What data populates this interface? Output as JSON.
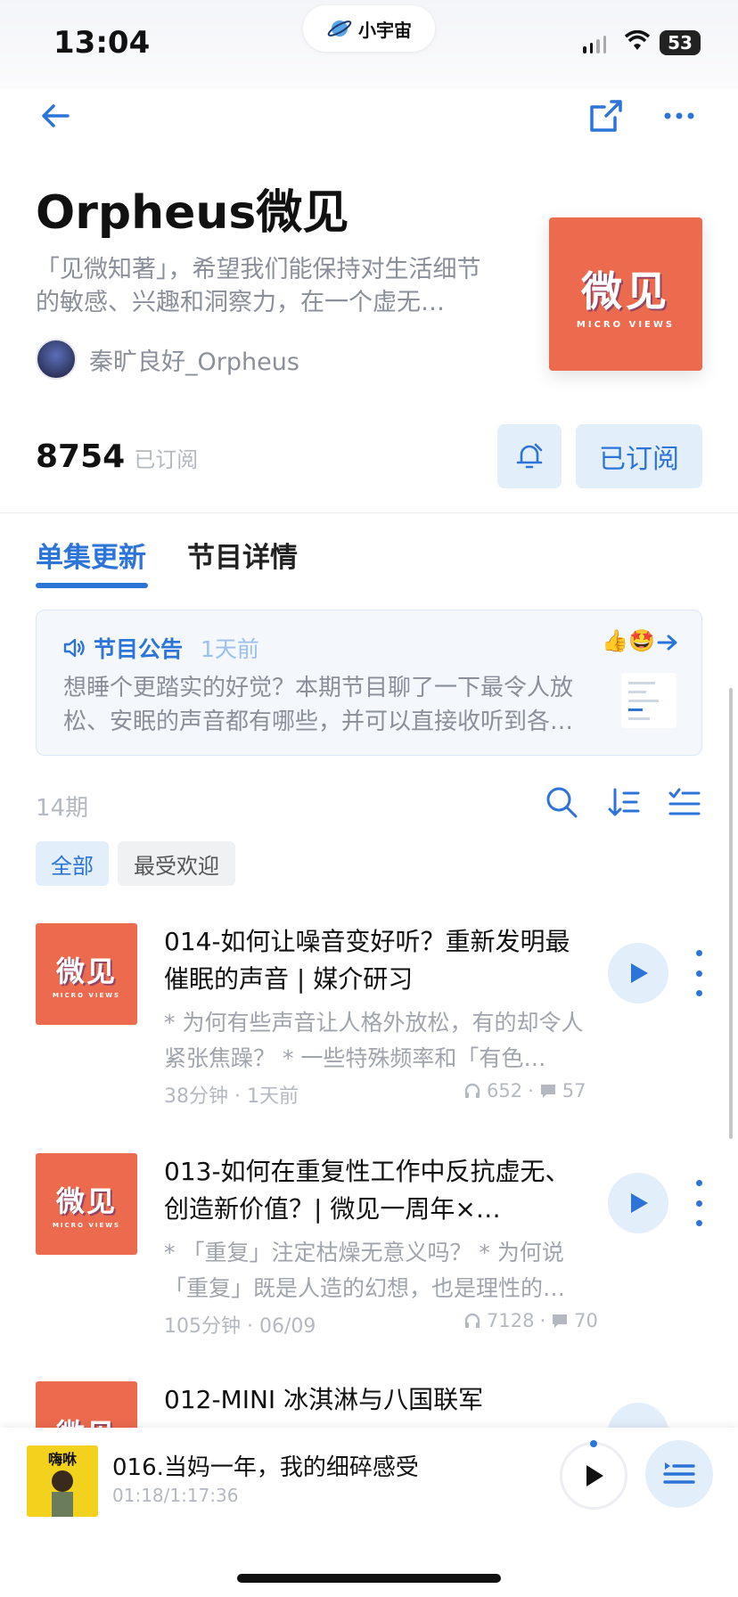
{
  "status": {
    "time": "13:04",
    "app_pill": "小宇宙",
    "battery": "53"
  },
  "podcast": {
    "title": "Orpheus微见",
    "description": "「见微知著」，希望我们能保持对生活细节的敏感、兴趣和洞察力，在一个虚无…",
    "cover_text": "微见",
    "cover_subtext": "MICRO VIEWS",
    "author": "秦旷良好_Orpheus",
    "subscribers": "8754",
    "subscribers_label": "已订阅",
    "subscribe_button": "已订阅"
  },
  "tabs": [
    "单集更新",
    "节目详情"
  ],
  "announcement": {
    "label": "节目公告",
    "time": "1天前",
    "emoji": "👍🤩",
    "text": "想睡个更踏实的好觉？本期节目聊了一下最令人放松、安眠的声音都有哪些，并可以直接收听到各…"
  },
  "list": {
    "count": "14期",
    "filters": [
      "全部",
      "最受欢迎"
    ]
  },
  "episodes": [
    {
      "title": "014-如何让噪音变好听？重新发明最催眠的声音 | 媒介研习",
      "desc": "* 为何有些声音让人格外放松，有的却令人紧张焦躁？ * 一些特殊频率和「有色…",
      "meta": "38分钟 · 1天前",
      "plays": "652",
      "comments": "57"
    },
    {
      "title": "013-如何在重复性工作中反抗虚无、创造新价值？| 微见一周年×…",
      "desc": "* 「重复」注定枯燥无意义吗？ * 为何说「重复」既是人造的幻想，也是理性的…",
      "meta": "105分钟 · 06/09",
      "plays": "7128",
      "comments": "70"
    },
    {
      "title": "012-MINI 冰淇淋与八国联军",
      "desc": "",
      "meta": "",
      "plays": "",
      "comments": ""
    }
  ],
  "player": {
    "title": "016.当妈一年，我的细碎感受",
    "time": "01:18/1:17:36",
    "cover_text": "嗨咻"
  },
  "colors": {
    "accent": "#2d74d8",
    "cover": "#ec6a4e",
    "light_accent": "#e3eefb"
  }
}
